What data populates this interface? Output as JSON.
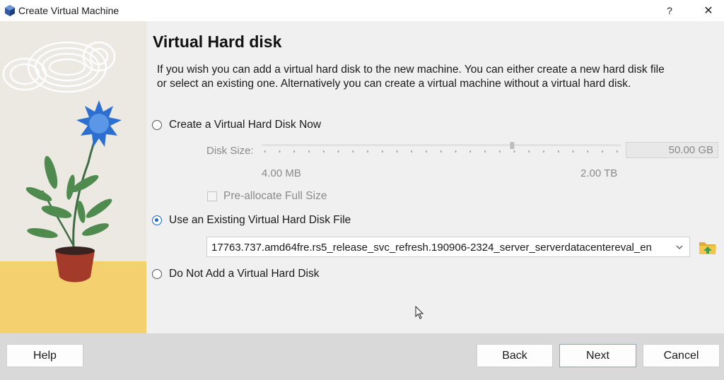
{
  "window": {
    "title": "Create Virtual Machine",
    "help_glyph": "?",
    "close_glyph": "✕"
  },
  "page": {
    "heading": "Virtual Hard disk",
    "description": "If you wish you can add a virtual hard disk to the new machine. You can either create a new hard disk file or select an existing one. Alternatively you can create a virtual machine without a virtual hard disk."
  },
  "options": {
    "create_new": {
      "label": "Create a Virtual Hard Disk Now",
      "selected": false
    },
    "use_existing": {
      "label": "Use an Existing Virtual Hard Disk File",
      "selected": true
    },
    "no_disk": {
      "label": "Do Not Add a Virtual Hard Disk",
      "selected": false
    }
  },
  "disk_size": {
    "label": "Disk Size:",
    "value": "50.00 GB",
    "min_label": "4.00 MB",
    "max_label": "2.00 TB",
    "slider_position_fraction": 0.7,
    "preallocate_label": "Pre-allocate Full Size",
    "preallocate_checked": false
  },
  "existing_file": {
    "selected": "17763.737.amd64fre.rs5_release_svc_refresh.190906-2324_server_serverdatacentereval_en"
  },
  "buttons": {
    "help": "Help",
    "back": "Back",
    "next": "Next",
    "cancel": "Cancel"
  },
  "colors": {
    "accent": "#1868c4",
    "footer": "#d9d9d9",
    "illustration_sun": "#f4d06f",
    "flower": "#2d6fd1"
  }
}
